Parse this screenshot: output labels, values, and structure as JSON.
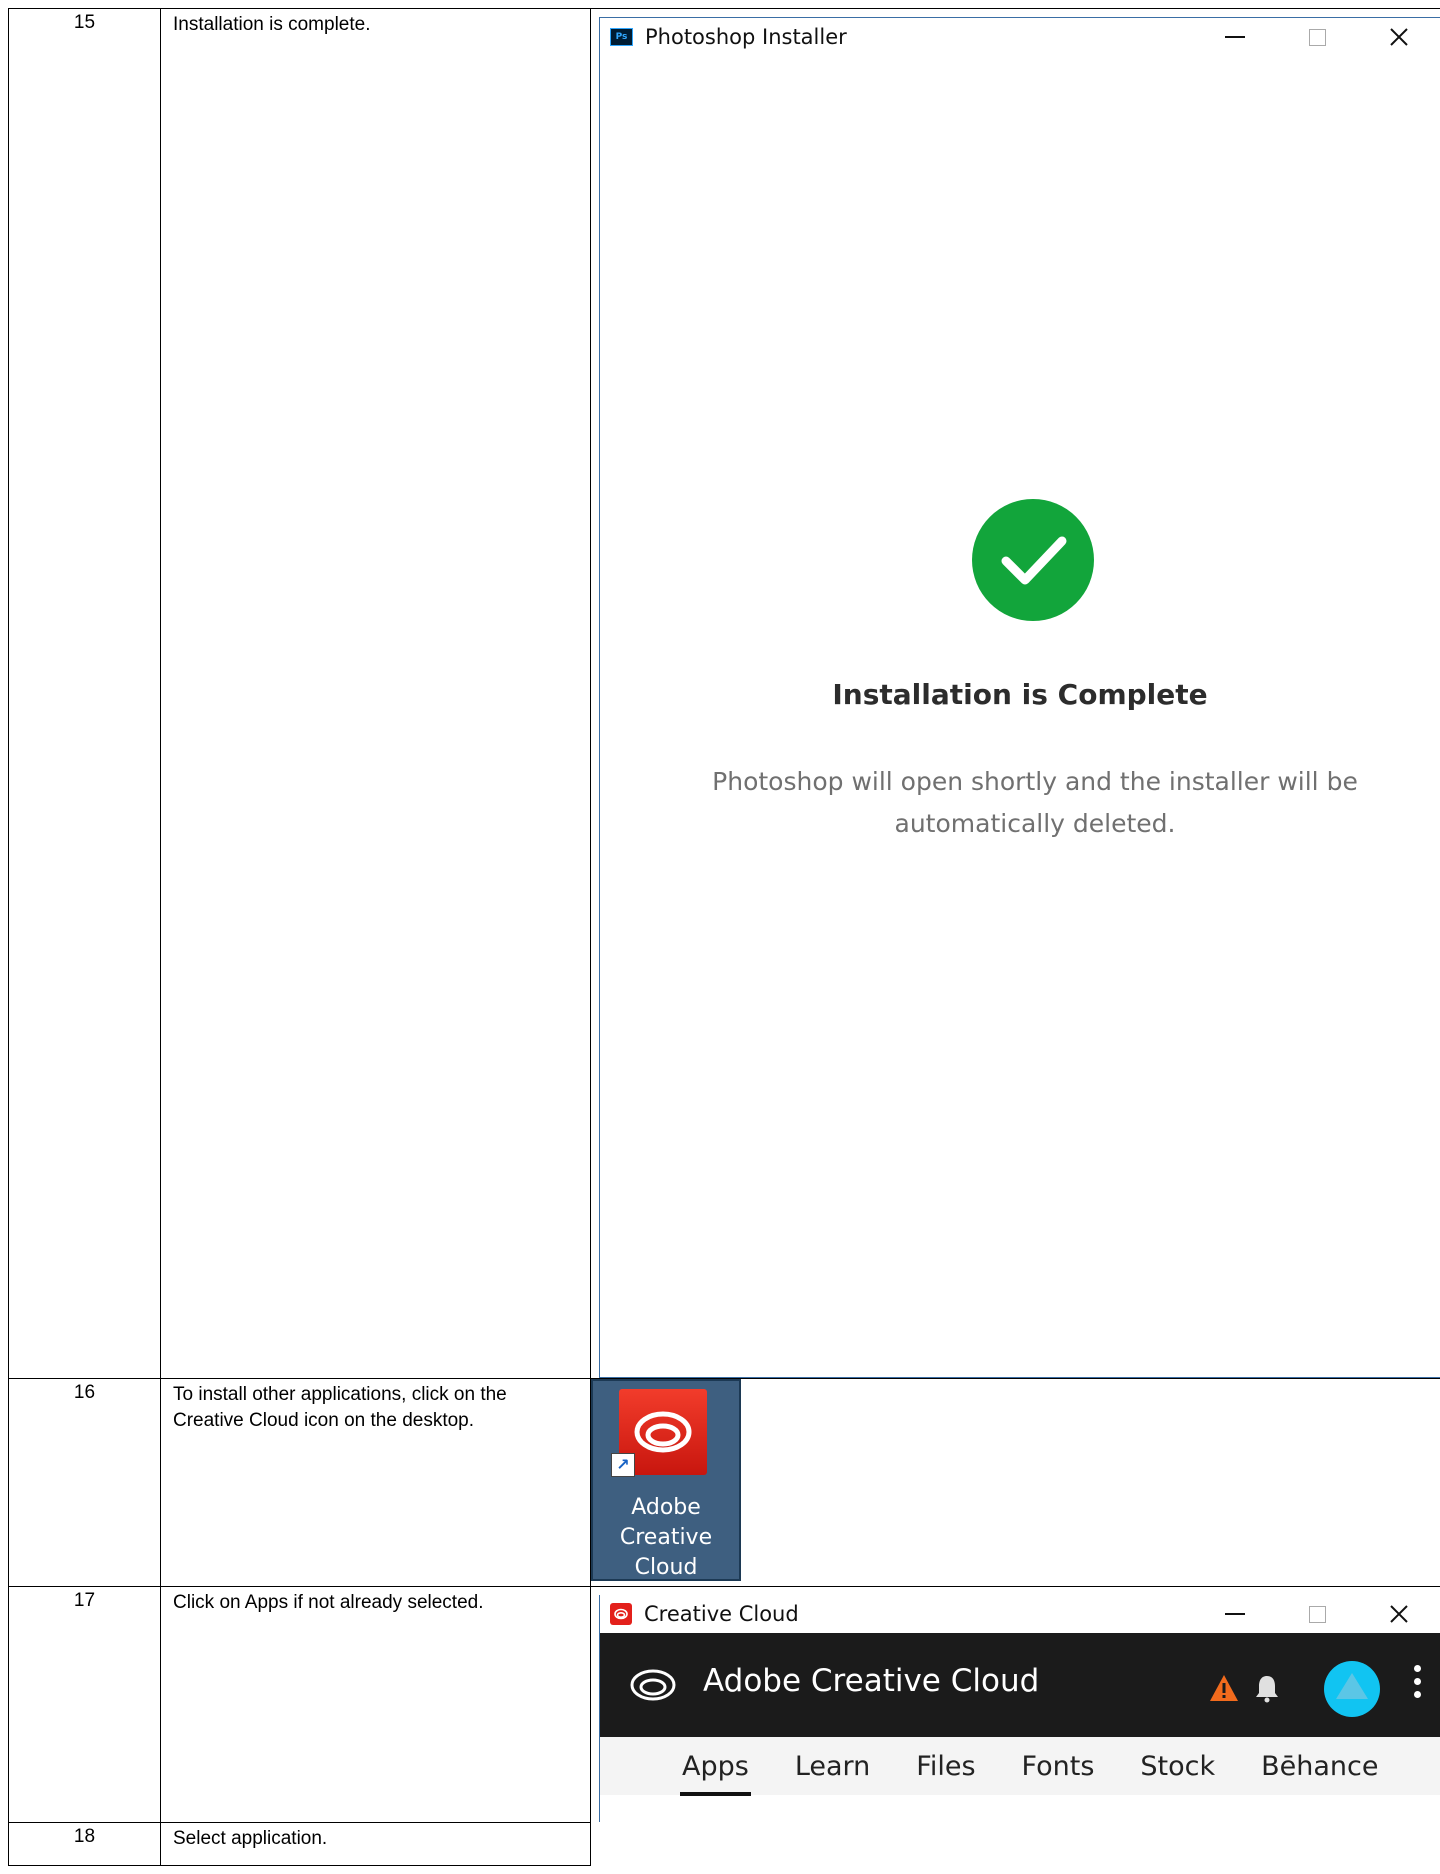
{
  "rows": [
    {
      "num": "15",
      "desc": "Installation is complete."
    },
    {
      "num": "16",
      "desc": "To install other applications, click on the Creative Cloud icon on the desktop."
    },
    {
      "num": "17",
      "desc": "Click on Apps if not already selected."
    },
    {
      "num": "18",
      "desc": "Select application."
    }
  ],
  "installer": {
    "title": "Photoshop Installer",
    "icon_text": "Ps",
    "complete_title": "Installation is Complete",
    "complete_msg": "Photoshop will open shortly and the installer will be automatically deleted."
  },
  "desktop_icon": {
    "label_lines": [
      "Adobe",
      "Creative",
      "Cloud"
    ]
  },
  "cc_app": {
    "window_title": "Creative Cloud",
    "header_title": "Adobe Creative Cloud",
    "tabs": [
      "Apps",
      "Learn",
      "Files",
      "Fonts",
      "Stock",
      "Bēhance"
    ],
    "active_tab": "Apps"
  },
  "colors": {
    "success_green": "#12a53b",
    "adobe_red": "#e3201b",
    "warning_orange": "#f26b1d",
    "avatar_blue": "#11c4f2"
  }
}
